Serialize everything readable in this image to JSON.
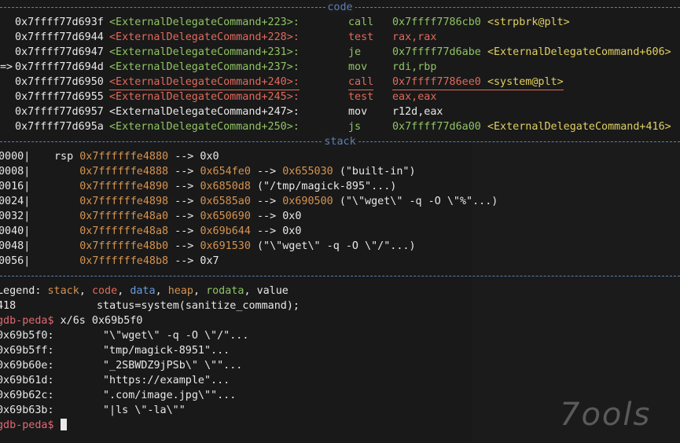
{
  "sections": {
    "code": "code",
    "stack": "stack"
  },
  "code": [
    {
      "arrow": "",
      "addr": "0x7ffff77d693f",
      "sym": "<ExternalDelegateCommand+223>:",
      "mnem": "call",
      "ops": "0x7ffff7786cb0",
      "target": "<strpbrk@plt>",
      "color": "green"
    },
    {
      "arrow": "",
      "addr": "0x7ffff77d6944",
      "sym": "<ExternalDelegateCommand+228>:",
      "mnem": "test",
      "ops": "rax,rax",
      "target": "",
      "color": "red"
    },
    {
      "arrow": "",
      "addr": "0x7ffff77d6947",
      "sym": "<ExternalDelegateCommand+231>:",
      "mnem": "je",
      "ops": "0x7ffff77d6abe",
      "target": "<ExternalDelegateCommand+606>",
      "color": "green"
    },
    {
      "arrow": "=>",
      "addr": "0x7ffff77d694d",
      "sym": "<ExternalDelegateCommand+237>:",
      "mnem": "mov",
      "ops": "rdi,rbp",
      "target": "",
      "color": "green"
    },
    {
      "arrow": "",
      "addr": "0x7ffff77d6950",
      "sym": "<ExternalDelegateCommand+240>:",
      "mnem": "call",
      "ops": "0x7ffff7786ee0",
      "target": "<system@plt>",
      "color": "red",
      "current": true
    },
    {
      "arrow": "",
      "addr": "0x7ffff77d6955",
      "sym": "<ExternalDelegateCommand+245>:",
      "mnem": "test",
      "ops": "eax,eax",
      "target": "",
      "color": "red"
    },
    {
      "arrow": "",
      "addr": "0x7ffff77d6957",
      "sym": "<ExternalDelegateCommand+247>:",
      "mnem": "mov",
      "ops": "r12d,eax",
      "target": "",
      "color": "white"
    },
    {
      "arrow": "",
      "addr": "0x7ffff77d695a",
      "sym": "<ExternalDelegateCommand+250>:",
      "mnem": "js",
      "ops": "0x7ffff77d6a00",
      "target": "<ExternalDelegateCommand+416>",
      "color": "green"
    }
  ],
  "stack": [
    {
      "off": "0000|",
      "reg": "rsp",
      "addr": "0x7ffffffe4880",
      "chain": "--> 0x0"
    },
    {
      "off": "0008|",
      "reg": "",
      "addr": "0x7ffffffe4888",
      "p1": "0x654fe0",
      "p2": "0x655030",
      "tail": "(\"built-in\")"
    },
    {
      "off": "0016|",
      "reg": "",
      "addr": "0x7ffffffe4890",
      "p1": "0x6850d8",
      "p2": "",
      "tail": "(\"/tmp/magick-895\"...)"
    },
    {
      "off": "0024|",
      "reg": "",
      "addr": "0x7ffffffe4898",
      "p1": "0x6585a0",
      "p2": "0x690500",
      "tail": "(\"\\\"wget\\\" -q -O \\\"%\"...)"
    },
    {
      "off": "0032|",
      "reg": "",
      "addr": "0x7ffffffe48a0",
      "p1": "0x650690",
      "p2": "",
      "tail": "--> 0x0"
    },
    {
      "off": "0040|",
      "reg": "",
      "addr": "0x7ffffffe48a8",
      "p1": "0x69b644",
      "p2": "",
      "tail": "--> 0x0"
    },
    {
      "off": "0048|",
      "reg": "",
      "addr": "0x7ffffffe48b0",
      "p1": "0x691530",
      "p2": "",
      "tail": "(\"\\\"wget\\\" -q -O \\\"/\"...)"
    },
    {
      "off": "0056|",
      "reg": "",
      "addr": "0x7ffffffe48b8",
      "p1": "",
      "p2": "",
      "tail": "--> 0x7"
    }
  ],
  "legend": {
    "prefix": "Legend:",
    "stack": "stack",
    "code": "code",
    "data": "data",
    "heap": "heap",
    "rodata": "rodata",
    "value": "value"
  },
  "source_line": {
    "num": "418",
    "text": "status=system(sanitize_command);"
  },
  "prompt": "gdb-peda$",
  "command": "x/6s 0x69b5f0",
  "dump": [
    {
      "addr": "0x69b5f0:",
      "val": "\"\\\"wget\\\" -q -O \\\"/\"..."
    },
    {
      "addr": "0x69b5ff:",
      "val": "\"tmp/magick-8951\"..."
    },
    {
      "addr": "0x69b60e:",
      "val": "\"_2SBWDZ9jPSb\\\" \\\"\"..."
    },
    {
      "addr": "0x69b61d:",
      "val": "\"https://example\"..."
    },
    {
      "addr": "0x69b62c:",
      "val": "\".com/image.jpg\\\"\"..."
    },
    {
      "addr": "0x69b63b:",
      "val": "\"|ls \\\"-la\\\"\""
    }
  ],
  "watermark": "7ools"
}
